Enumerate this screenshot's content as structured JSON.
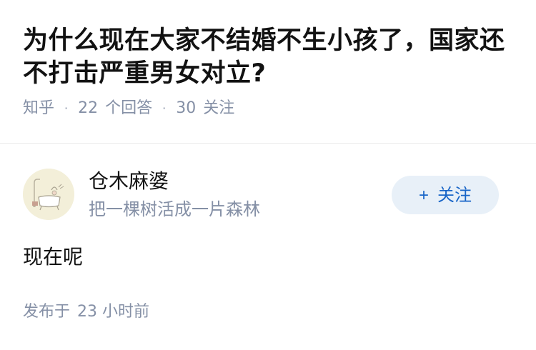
{
  "question": {
    "title": "为什么现在大家不结婚不生小孩了，国家还不打击严重男女对立?",
    "source": "知乎",
    "answer_count": "22",
    "answer_label": "个回答",
    "follow_count": "30",
    "follow_label": "关注"
  },
  "author": {
    "name": "仓木麻婆",
    "bio": "把一棵树活成一片森林",
    "avatar_icon": "avatar-illustration-icon",
    "follow_button": {
      "icon": "plus-icon",
      "plus": "+",
      "label": "关注"
    }
  },
  "answer": {
    "content": "现在呢",
    "published_prefix": "发布于",
    "published_time": "23 小时前"
  },
  "colors": {
    "text_primary": "#121212",
    "text_secondary": "#8590a6",
    "accent": "#1a66c8",
    "button_bg": "#e8f0f8"
  }
}
